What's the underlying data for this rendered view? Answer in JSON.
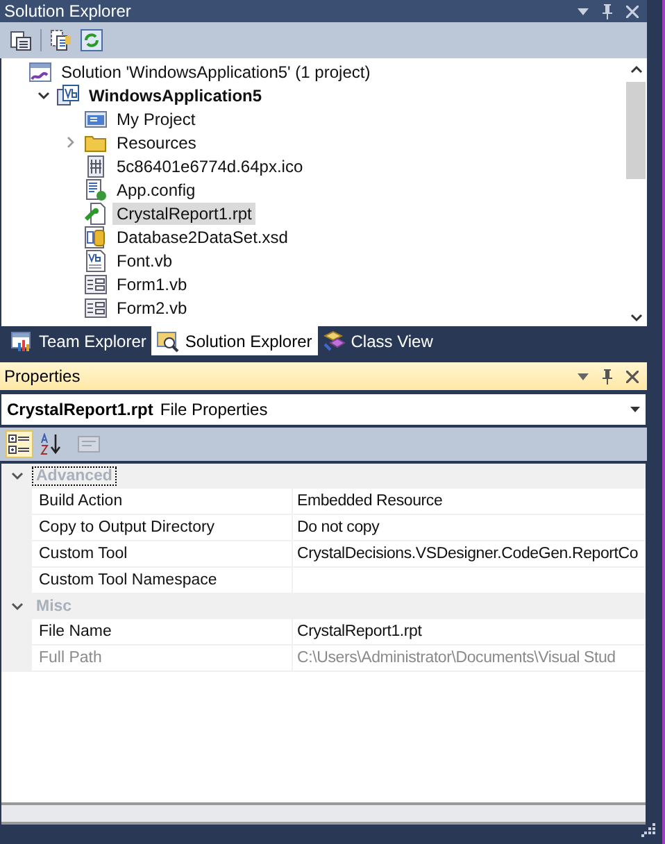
{
  "solution_explorer": {
    "title": "Solution Explorer",
    "toolbar": [
      {
        "kind": "properties"
      },
      {
        "kind": "showall"
      },
      {
        "kind": "refresh"
      }
    ],
    "tree": [
      {
        "label": "Solution 'WindowsApplication5' (1 project)",
        "kind": "solution",
        "bold": false,
        "selected": false,
        "children": [
          {
            "label": "WindowsApplication5",
            "kind": "vbproject",
            "bold": true,
            "selected": false,
            "expanded": true,
            "children": [
              {
                "label": "My Project",
                "kind": "myproject",
                "bold": false,
                "selected": false
              },
              {
                "label": "Resources",
                "kind": "folder",
                "bold": false,
                "selected": false,
                "expanded": false
              },
              {
                "label": "5c86401e6774d.64px.ico",
                "kind": "ico",
                "bold": false,
                "selected": false
              },
              {
                "label": "App.config",
                "kind": "config",
                "bold": false,
                "selected": false
              },
              {
                "label": "CrystalReport1.rpt",
                "kind": "report",
                "bold": false,
                "selected": true
              },
              {
                "label": "Database2DataSet.xsd",
                "kind": "dataset",
                "bold": false,
                "selected": false
              },
              {
                "label": "Font.vb",
                "kind": "vbfile",
                "bold": false,
                "selected": false
              },
              {
                "label": "Form1.vb",
                "kind": "form",
                "bold": false,
                "selected": false
              },
              {
                "label": "Form2.vb",
                "kind": "form",
                "bold": false,
                "selected": false
              }
            ]
          }
        ]
      }
    ]
  },
  "tabs": [
    {
      "label": "Team Explorer",
      "kind": "team",
      "selected": false
    },
    {
      "label": "Solution Explorer",
      "kind": "solution",
      "selected": true
    },
    {
      "label": "Class View",
      "kind": "classview",
      "selected": false
    }
  ],
  "properties": {
    "title": "Properties",
    "object_name": "CrystalReport1.rpt",
    "object_type": "File Properties",
    "toolbar": [
      {
        "kind": "categorized",
        "selected": true,
        "disabled": false
      },
      {
        "kind": "alphabetical",
        "selected": false,
        "disabled": false
      },
      {
        "kind": "pages",
        "selected": false,
        "disabled": true
      }
    ],
    "categories": [
      {
        "name": "Advanced",
        "expanded": true,
        "focused": true,
        "rows": [
          {
            "name": "Build Action",
            "value": "Embedded Resource",
            "readonly": false
          },
          {
            "name": "Copy to Output Directory",
            "value": "Do not copy",
            "readonly": false
          },
          {
            "name": "Custom Tool",
            "value": "CrystalDecisions.VSDesigner.CodeGen.ReportCo",
            "readonly": false
          },
          {
            "name": "Custom Tool Namespace",
            "readonly": false
          }
        ]
      },
      {
        "name": "Misc",
        "expanded": true,
        "focused": false,
        "rows": [
          {
            "name": "File Name",
            "value": "CrystalReport1.rpt",
            "readonly": false
          },
          {
            "name": "Full Path",
            "value": "C:\\Users\\Administrator\\Documents\\Visual Stud",
            "readonly": true
          }
        ]
      }
    ]
  }
}
